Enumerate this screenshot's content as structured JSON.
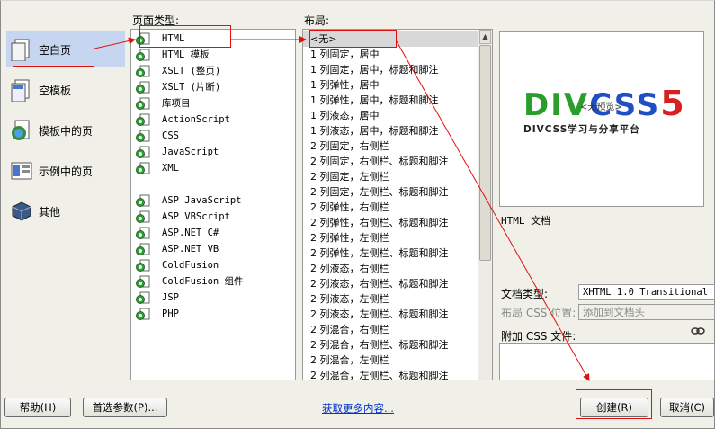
{
  "categories": [
    {
      "label": "空白页",
      "icon": "blank-page-icon"
    },
    {
      "label": "空模板",
      "icon": "blank-template-icon"
    },
    {
      "label": "模板中的页",
      "icon": "page-from-template-icon"
    },
    {
      "label": "示例中的页",
      "icon": "page-from-sample-icon"
    },
    {
      "label": "其他",
      "icon": "other-icon"
    }
  ],
  "page_type": {
    "header": "页面类型:",
    "items": [
      "HTML",
      "HTML 模板",
      "XSLT (整页)",
      "XSLT (片断)",
      "库项目",
      "ActionScript",
      "CSS",
      "JavaScript",
      "XML",
      "",
      "ASP JavaScript",
      "ASP VBScript",
      "ASP.NET C#",
      "ASP.NET VB",
      "ColdFusion",
      "ColdFusion 组件",
      "JSP",
      "PHP"
    ],
    "selected": "HTML"
  },
  "layout": {
    "header": "布局:",
    "items": [
      "<无>",
      "1 列固定，居中",
      "1 列固定，居中，标题和脚注",
      "1 列弹性，居中",
      "1 列弹性，居中，标题和脚注",
      "1 列液态，居中",
      "1 列液态，居中，标题和脚注",
      "2 列固定，右侧栏",
      "2 列固定，右侧栏、标题和脚注",
      "2 列固定，左侧栏",
      "2 列固定，左侧栏、标题和脚注",
      "2 列弹性，右侧栏",
      "2 列弹性，右侧栏、标题和脚注",
      "2 列弹性，左侧栏",
      "2 列弹性，左侧栏、标题和脚注",
      "2 列液态，右侧栏",
      "2 列液态，右侧栏、标题和脚注",
      "2 列液态，左侧栏",
      "2 列液态，左侧栏、标题和脚注",
      "2 列混合，右侧栏",
      "2 列混合，右侧栏、标题和脚注",
      "2 列混合，左侧栏",
      "2 列混合，左侧栏、标题和脚注"
    ],
    "selected": "<无>"
  },
  "preview": {
    "logo_div": "DIV",
    "logo_css": "CSS",
    "logo_5": "5",
    "logo_sub": "DIVCSS学习与分享平台",
    "tag": "<无预览>",
    "description": "HTML 文档"
  },
  "form": {
    "doctype_label": "文档类型:",
    "doctype_value": "XHTML 1.0 Transitional",
    "layout_css_label": "布局 CSS 位置:",
    "layout_css_value": "添加到文档头",
    "attach_css_label": "附加 CSS 文件:",
    "link_icon": "chain-link-icon"
  },
  "buttons": {
    "help": "帮助(H)",
    "preferences": "首选参数(P)...",
    "more_content": "获取更多内容...",
    "create": "创建(R)",
    "cancel": "取消(C)"
  },
  "colors": {
    "logo_green": "#2a9d2a",
    "logo_blue": "#1f4fc4",
    "logo_red": "#d82020",
    "annotation_red": "#e01010",
    "link_blue": "#0033cc"
  }
}
